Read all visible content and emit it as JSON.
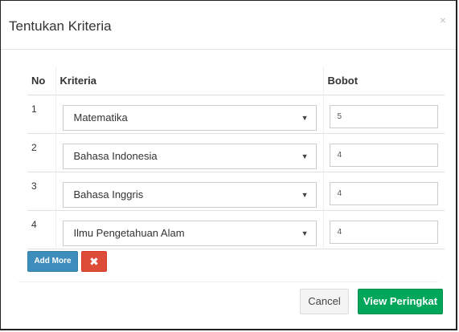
{
  "modal": {
    "title": "Tentukan Kriteria",
    "close_icon": "×"
  },
  "table": {
    "headers": {
      "no": "No",
      "kriteria": "Kriteria",
      "bobot": "Bobot"
    },
    "rows": [
      {
        "no": "1",
        "kriteria": "Matematika",
        "bobot": "5"
      },
      {
        "no": "2",
        "kriteria": "Bahasa Indonesia",
        "bobot": "4"
      },
      {
        "no": "3",
        "kriteria": "Bahasa Inggris",
        "bobot": "4"
      },
      {
        "no": "4",
        "kriteria": "Ilmu Pengetahuan Alam",
        "bobot": "4"
      }
    ],
    "caret_icon": "▼"
  },
  "actions": {
    "add_more_label": "Add More",
    "remove_icon": "✖",
    "cancel_label": "Cancel",
    "view_label": "View Peringkat"
  },
  "colors": {
    "primary": "#3c8dbc",
    "danger": "#dd4b39",
    "success": "#00a65a",
    "default": "#f4f4f4"
  }
}
